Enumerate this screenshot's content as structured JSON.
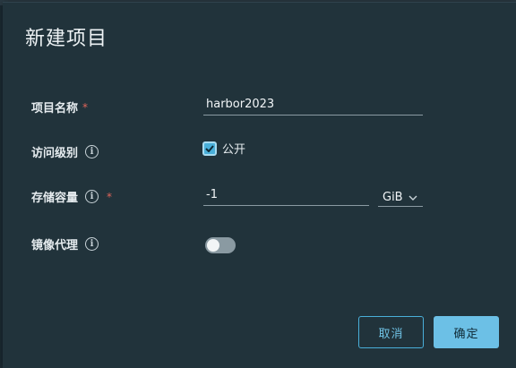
{
  "dialog": {
    "title": "新建项目"
  },
  "form": {
    "project_name": {
      "label": "项目名称",
      "required_mark": "*",
      "value": "harbor2023"
    },
    "access_level": {
      "label": "访问级别",
      "info_icon": "info-icon",
      "checkbox_label": "公开",
      "checked": true
    },
    "storage_quota": {
      "label": "存储容量",
      "info_icon": "info-icon",
      "required_mark": "*",
      "value": "-1",
      "unit": "GiB"
    },
    "proxy_cache": {
      "label": "镜像代理",
      "info_icon": "info-icon",
      "enabled": false
    }
  },
  "buttons": {
    "cancel_label": "取消",
    "ok_label": "确定"
  },
  "colors": {
    "accent": "#49afd9",
    "primary_button": "#6cc0e6",
    "required": "#e0655a",
    "dialog_background": "#21333b"
  }
}
